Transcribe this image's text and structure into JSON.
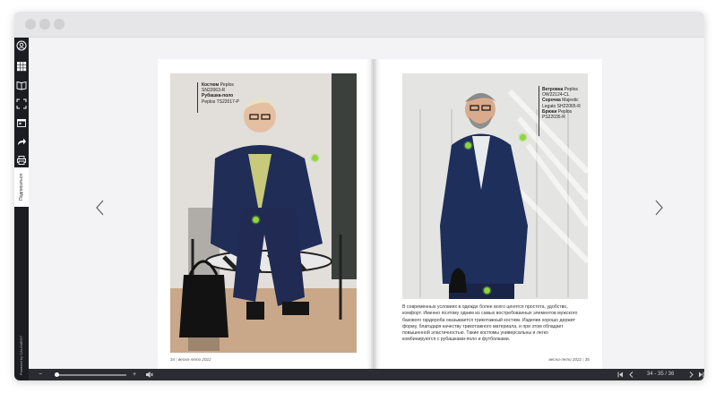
{
  "sidebar": {
    "icons": [
      "user-circle-icon",
      "grid-icon",
      "book-icon",
      "fullscreen-icon",
      "calendar-icon",
      "share-icon",
      "print-icon"
    ],
    "subscribe_label": "Подписаться",
    "powered_label": "Powered by CALAMEO?"
  },
  "left_page": {
    "label_lines": [
      {
        "bold": "Костюм",
        "rest": " Peplos"
      },
      {
        "bold": "",
        "rest": "SN22063-R"
      },
      {
        "bold": "Рубашка-поло",
        "rest": ""
      },
      {
        "bold": "",
        "rest": "Peplos TS22017-P"
      }
    ],
    "page_number": "34",
    "footer_text": "весна-лето 2022"
  },
  "right_page": {
    "label_lines": [
      {
        "bold": "Ветровка",
        "rest": " Peplos"
      },
      {
        "bold": "",
        "rest": "OW22124-CL"
      },
      {
        "bold": "Сорочка",
        "rest": " Majestic"
      },
      {
        "bold": "",
        "rest": "Legato SH22065-R"
      },
      {
        "bold": "Брюки",
        "rest": " Peplos"
      },
      {
        "bold": "",
        "rest": "PS22035-R"
      }
    ],
    "description": "В современных условиях в одежде более всего ценятся простота, удобство, комфорт. Именно поэтому одним из самых востребованных элементов мужского базового гардероба оказывается трикотажный костюм. Изделие хорошо держит форму, благодаря качеству трикотажного материала, и при этом обладает повышенной эластичностью. Такие костюмы универсальны и легко комбинируются с рубашками-поло и футболками.",
    "page_number": "35",
    "footer_text": "весна-лето 2022"
  },
  "bottombar": {
    "zoom_out": "−",
    "zoom_in": "+",
    "page_indicator": "34 - 35 / 36"
  },
  "colors": {
    "hotspot": "#8fd63a",
    "sidebar": "#1b1d22",
    "bottombar": "#2a2c31"
  }
}
